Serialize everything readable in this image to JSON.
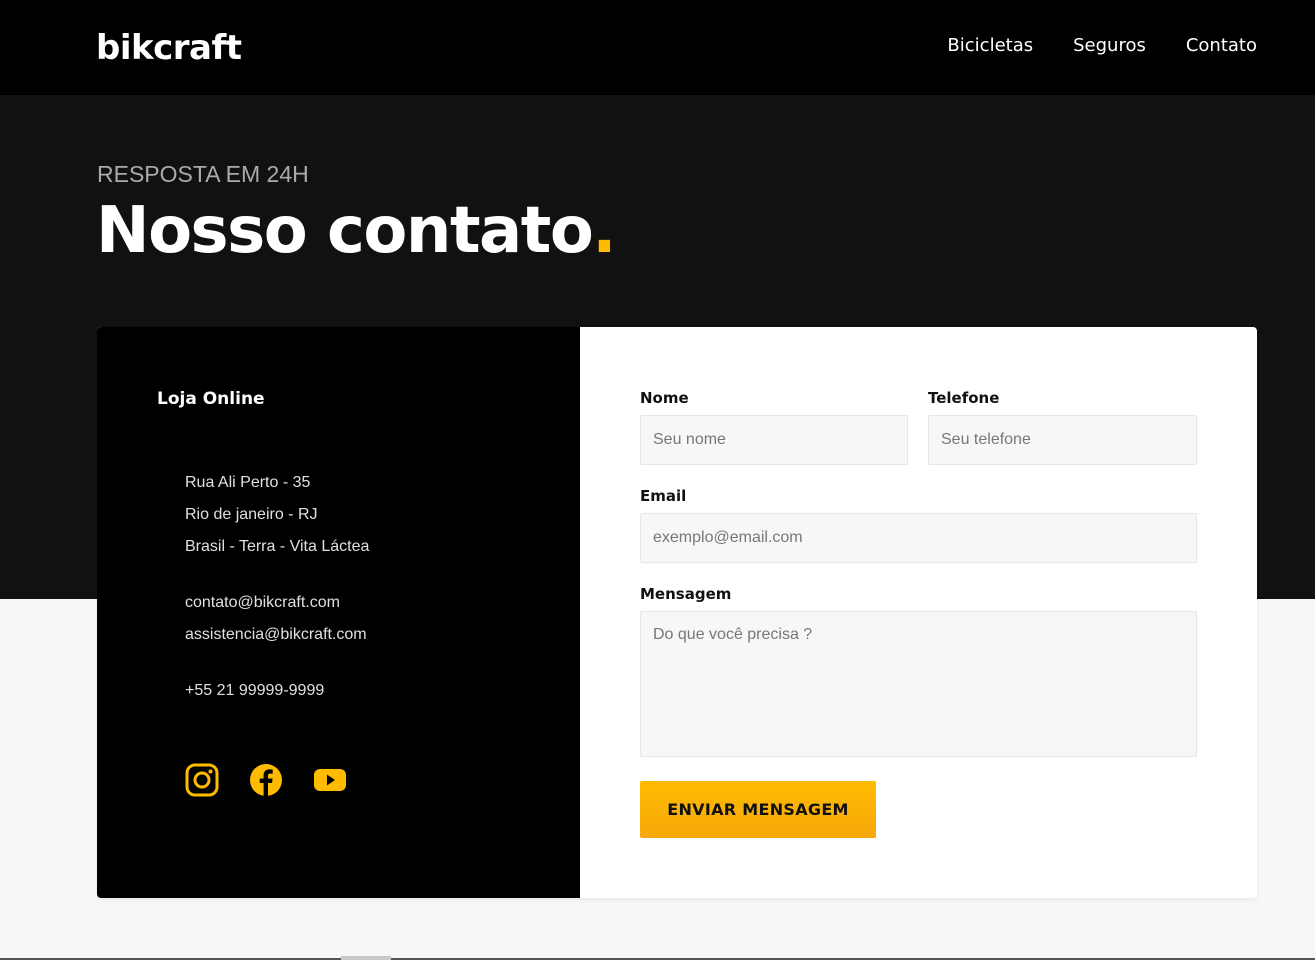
{
  "header": {
    "logo": "bikcraft",
    "nav": [
      {
        "label": "Bicicletas"
      },
      {
        "label": "Seguros"
      },
      {
        "label": "Contato"
      }
    ]
  },
  "hero": {
    "subtitle": "RESPOSTA EM 24H",
    "title": "Nosso contato",
    "title_dot": "."
  },
  "info": {
    "title": "Loja Online",
    "address": [
      "Rua Ali Perto - 35",
      "Rio de janeiro - RJ",
      "Brasil - Terra - Vita Láctea"
    ],
    "emails": [
      "contato@bikcraft.com",
      "assistencia@bikcraft.com"
    ],
    "phone": "+55 21 99999-9999",
    "social": [
      {
        "icon": "instagram-icon"
      },
      {
        "icon": "facebook-icon"
      },
      {
        "icon": "youtube-icon"
      }
    ]
  },
  "form": {
    "name_label": "Nome",
    "name_placeholder": "Seu nome",
    "phone_label": "Telefone",
    "phone_placeholder": "Seu telefone",
    "email_label": "Email",
    "email_placeholder": "exemplo@email.com",
    "message_label": "Mensagem",
    "message_placeholder": "Do que você precisa ?",
    "submit_label": "ENVIAR MENSAGEM"
  },
  "colors": {
    "accent": "#ffbb00",
    "dark": "#000000",
    "hero_bg": "#111111",
    "page_bg": "#f7f7f7"
  }
}
